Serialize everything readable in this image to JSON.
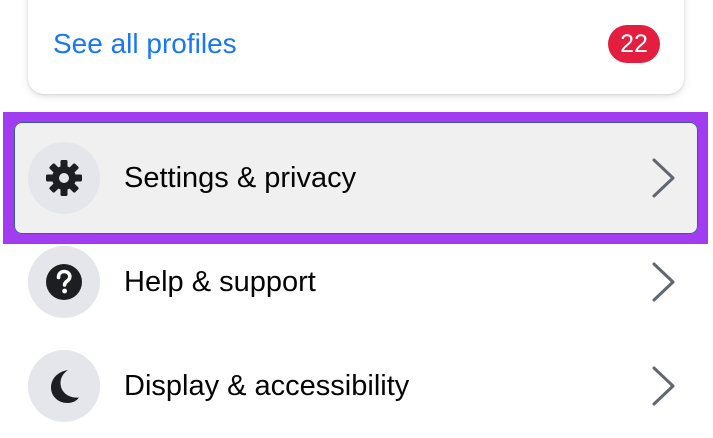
{
  "profiles": {
    "see_all_label": "See all profiles",
    "badge_count": "22"
  },
  "menu": {
    "items": [
      {
        "label": "Settings & privacy",
        "icon": "gear-icon",
        "selected": true
      },
      {
        "label": "Help & support",
        "icon": "question-mark-icon",
        "selected": false
      },
      {
        "label": "Display & accessibility",
        "icon": "moon-icon",
        "selected": false
      }
    ]
  },
  "colors": {
    "link": "#1877f2",
    "badge": "#e41e3f",
    "highlight": "#a13cf0",
    "icon_bg": "#e4e6eb",
    "selected_bg": "#f0f0f0"
  }
}
